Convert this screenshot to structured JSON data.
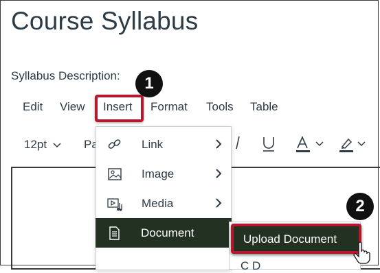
{
  "page": {
    "title": "Course Syllabus",
    "description_label": "Syllabus Description:"
  },
  "menubar": {
    "items": [
      "Edit",
      "View",
      "Insert",
      "Format",
      "Tools",
      "Table"
    ]
  },
  "toolbar": {
    "font_size": "12pt",
    "paragraph_partial": "Pa"
  },
  "insert_menu": {
    "items": [
      {
        "label": "Link",
        "icon": "link-icon"
      },
      {
        "label": "Image",
        "icon": "image-icon"
      },
      {
        "label": "Media",
        "icon": "media-icon"
      },
      {
        "label": "Document",
        "icon": "document-icon"
      }
    ]
  },
  "document_submenu": {
    "upload_label": "Upload Document",
    "next_partial": "C     D"
  },
  "steps": {
    "one": "1",
    "two": "2"
  },
  "colors": {
    "highlight": "#223121",
    "outline": "#b5182e",
    "text": "#2d3b45"
  }
}
